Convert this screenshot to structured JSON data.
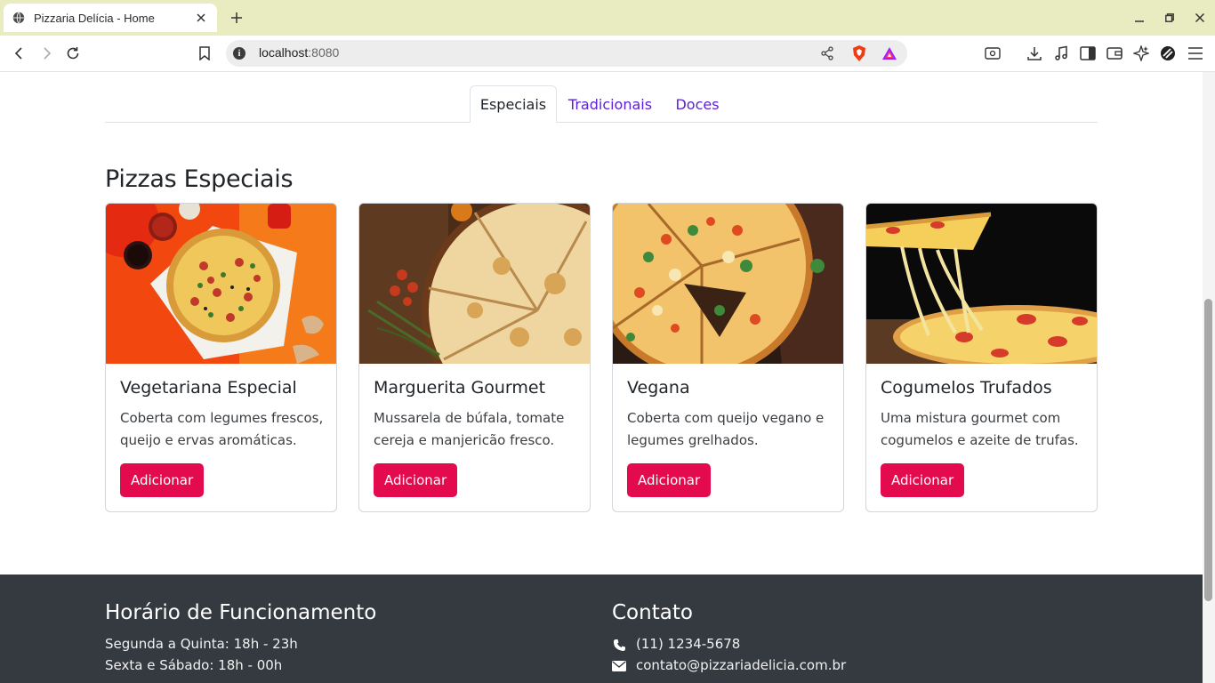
{
  "browser": {
    "tab_title": "Pizzaria Delícia - Home",
    "url_host": "localhost",
    "url_port": ":8080"
  },
  "menu_tabs": [
    {
      "label": "Especiais",
      "active": true
    },
    {
      "label": "Tradicionais",
      "active": false
    },
    {
      "label": "Doces",
      "active": false
    }
  ],
  "section": {
    "title": "Pizzas Especiais"
  },
  "cards": [
    {
      "title": "Vegetariana Especial",
      "text": "Coberta com legumes frescos, queijo e ervas aromáticas.",
      "button": "Adicionar"
    },
    {
      "title": "Marguerita Gourmet",
      "text": "Mussarela de búfala, tomate cereja e manjericão fresco.",
      "button": "Adicionar"
    },
    {
      "title": "Vegana",
      "text": "Coberta com queijo vegano e legumes grelhados.",
      "button": "Adicionar"
    },
    {
      "title": "Cogumelos Trufados",
      "text": "Uma mistura gourmet com cogumelos e azeite de trufas.",
      "button": "Adicionar"
    }
  ],
  "footer": {
    "hours": {
      "title": "Horário de Funcionamento",
      "lines": [
        "Segunda a Quinta: 18h - 23h",
        "Sexta e Sábado: 18h - 00h"
      ]
    },
    "contact": {
      "title": "Contato",
      "phone": "(11) 1234-5678",
      "email": "contato@pizzariadelicia.com.br"
    }
  },
  "colors": {
    "accent_button": "#e30b4e",
    "nav_link": "#5b21d6",
    "footer_bg": "#343a40",
    "titlebar_bg": "#e9ebc1"
  },
  "icons": [
    "globe-icon",
    "close-icon",
    "plus-icon",
    "back-icon",
    "forward-icon",
    "reload-icon",
    "bookmark-icon",
    "info-icon",
    "share-icon",
    "brave-shield-icon",
    "brave-rewards-icon",
    "reader-icon",
    "download-icon",
    "music-icon",
    "sidebar-icon",
    "wallet-icon",
    "leo-ai-icon",
    "vpn-icon",
    "menu-icon",
    "phone-icon",
    "envelope-icon"
  ]
}
